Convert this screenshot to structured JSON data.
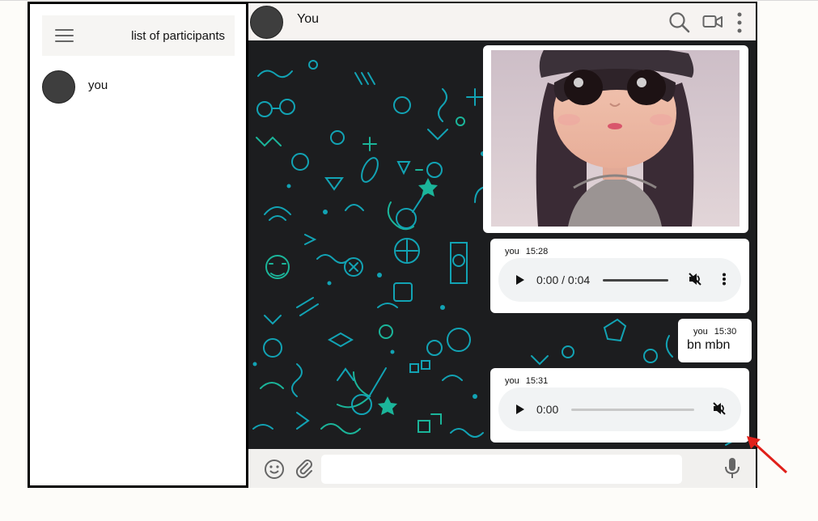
{
  "sidebar": {
    "title": "list of participants",
    "menu_icon": "hamburger-menu-icon",
    "participants": [
      {
        "name": "you"
      }
    ]
  },
  "chat": {
    "title": "You",
    "header_icons": [
      "search-icon",
      "video-camera-icon",
      "more-vertical-icon"
    ]
  },
  "messages": [
    {
      "type": "image",
      "sender": "",
      "time": ""
    },
    {
      "type": "audio",
      "sender": "you",
      "time": "15:28",
      "audio_time": "0:00 / 0:04",
      "progress": 0.0,
      "muted": true
    },
    {
      "type": "text",
      "sender": "you",
      "time": "15:30",
      "text": "bn mbn"
    },
    {
      "type": "audio",
      "sender": "you",
      "time": "15:31",
      "audio_time": "0:00",
      "progress": 0.0,
      "muted": true
    }
  ],
  "composer": {
    "value": "",
    "placeholder": "",
    "icons": [
      "emoji-icon",
      "attachment-icon",
      "microphone-icon"
    ]
  },
  "colors": {
    "chat_background": "#1c1d1f",
    "doodle_cyan": "#12a3b4",
    "doodle_teal": "#1bb59a",
    "annotation_arrow": "#e0201a"
  }
}
